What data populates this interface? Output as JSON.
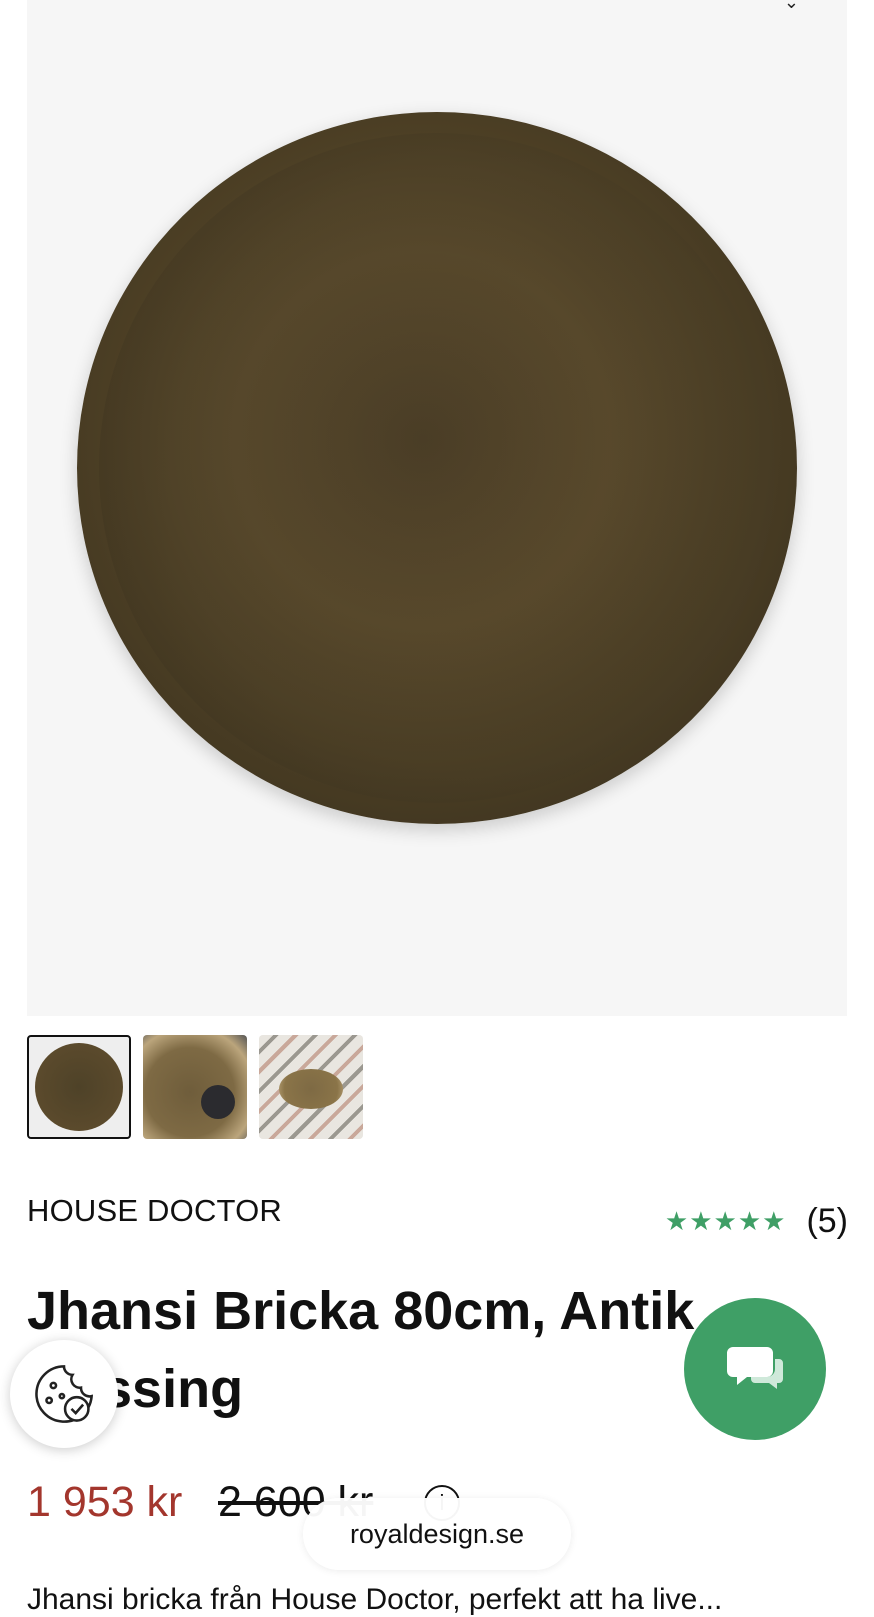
{
  "product": {
    "brand": "HOUSE DOCTOR",
    "title": "Jhansi Bricka 80cm, Antik Mässing",
    "price": "1 953 kr",
    "old_price": "2 600 kr",
    "rating": {
      "stars": "★★★★★",
      "value": 5,
      "max": 5,
      "count": "(5)"
    },
    "description": "Jhansi bricka från House Doctor, perfekt att ha live..."
  },
  "gallery": {
    "thumbnails": 3,
    "selected_index": 0
  },
  "browser": {
    "url": "royaldesign.se"
  },
  "colors": {
    "accent_green": "#3f9f66",
    "price_red": "#a3362d"
  },
  "icons": {
    "cookie": "cookie-icon",
    "chat": "chat-icon",
    "info": "info-icon"
  }
}
